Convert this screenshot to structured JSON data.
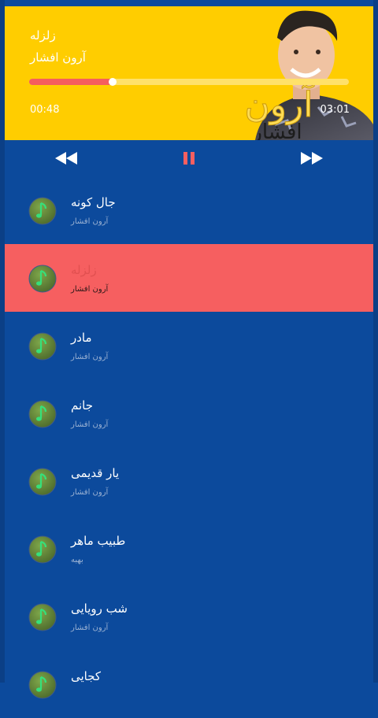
{
  "now_playing": {
    "title": "زلزله",
    "artist": "آرون افشار",
    "progress_fraction": 0.26,
    "elapsed": "00:48",
    "duration": "03:01"
  },
  "controls": {
    "prev_icon": "rewind-icon",
    "pause_icon": "pause-icon",
    "next_icon": "fast-forward-icon"
  },
  "songs": [
    {
      "title": "جال کونه",
      "artist": "آرون افشار",
      "active": false
    },
    {
      "title": "زلزله",
      "artist": "آرون افشار",
      "active": true
    },
    {
      "title": "مادر",
      "artist": "آرون افشار",
      "active": false
    },
    {
      "title": "جانم",
      "artist": "آرون افشار",
      "active": false
    },
    {
      "title": "یار قدیمی",
      "artist": "آرون افشار",
      "active": false
    },
    {
      "title": "طبیب ماهر",
      "artist": "بهبه",
      "active": false
    },
    {
      "title": "شب رویایی",
      "artist": "آرون افشار",
      "active": false
    },
    {
      "title": "کجایی",
      "artist": "",
      "active": false
    }
  ],
  "colors": {
    "background": "#0c4a9c",
    "player_bg": "#ffcd00",
    "accent": "#f65f60"
  }
}
